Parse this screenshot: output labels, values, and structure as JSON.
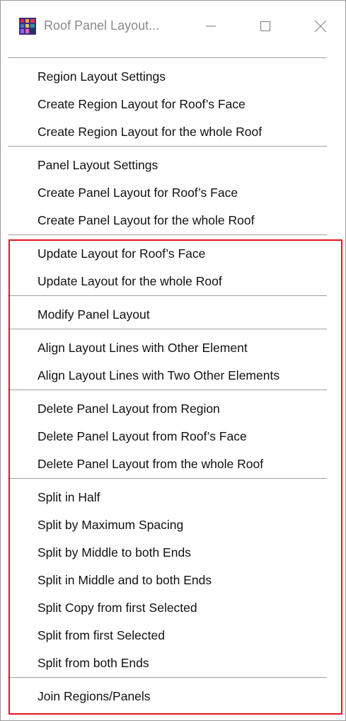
{
  "window": {
    "title": "Roof Panel Layout...",
    "accent_color": "#e81123"
  },
  "menu": {
    "group1": [
      "Region Layout Settings",
      "Create Region Layout for Roof’s Face",
      "Create Region Layout for the whole Roof"
    ],
    "group2": [
      "Panel Layout Settings",
      "Create Panel Layout for Roof’s Face",
      "Create Panel Layout for the whole Roof"
    ],
    "group3": [
      "Update Layout for Roof’s Face",
      "Update Layout for the whole Roof"
    ],
    "group4": [
      "Modify Panel Layout"
    ],
    "group5": [
      "Align Layout Lines with Other Element",
      "Align Layout Lines with Two Other Elements"
    ],
    "group6": [
      "Delete Panel Layout from Region",
      "Delete Panel Layout from Roof’s Face",
      "Delete Panel Layout from the whole Roof"
    ],
    "group7": [
      "Split in Half",
      "Split by Maximum Spacing",
      "Split by Middle to both Ends",
      "Split in Middle and to both Ends",
      "Split Copy from first Selected",
      "Split from first Selected",
      "Split from both Ends"
    ],
    "group8": [
      "Join Regions/Panels"
    ]
  },
  "icons": {
    "app": "app-icon",
    "minimize": "minimize-icon",
    "maximize": "maximize-icon",
    "close": "close-icon"
  }
}
